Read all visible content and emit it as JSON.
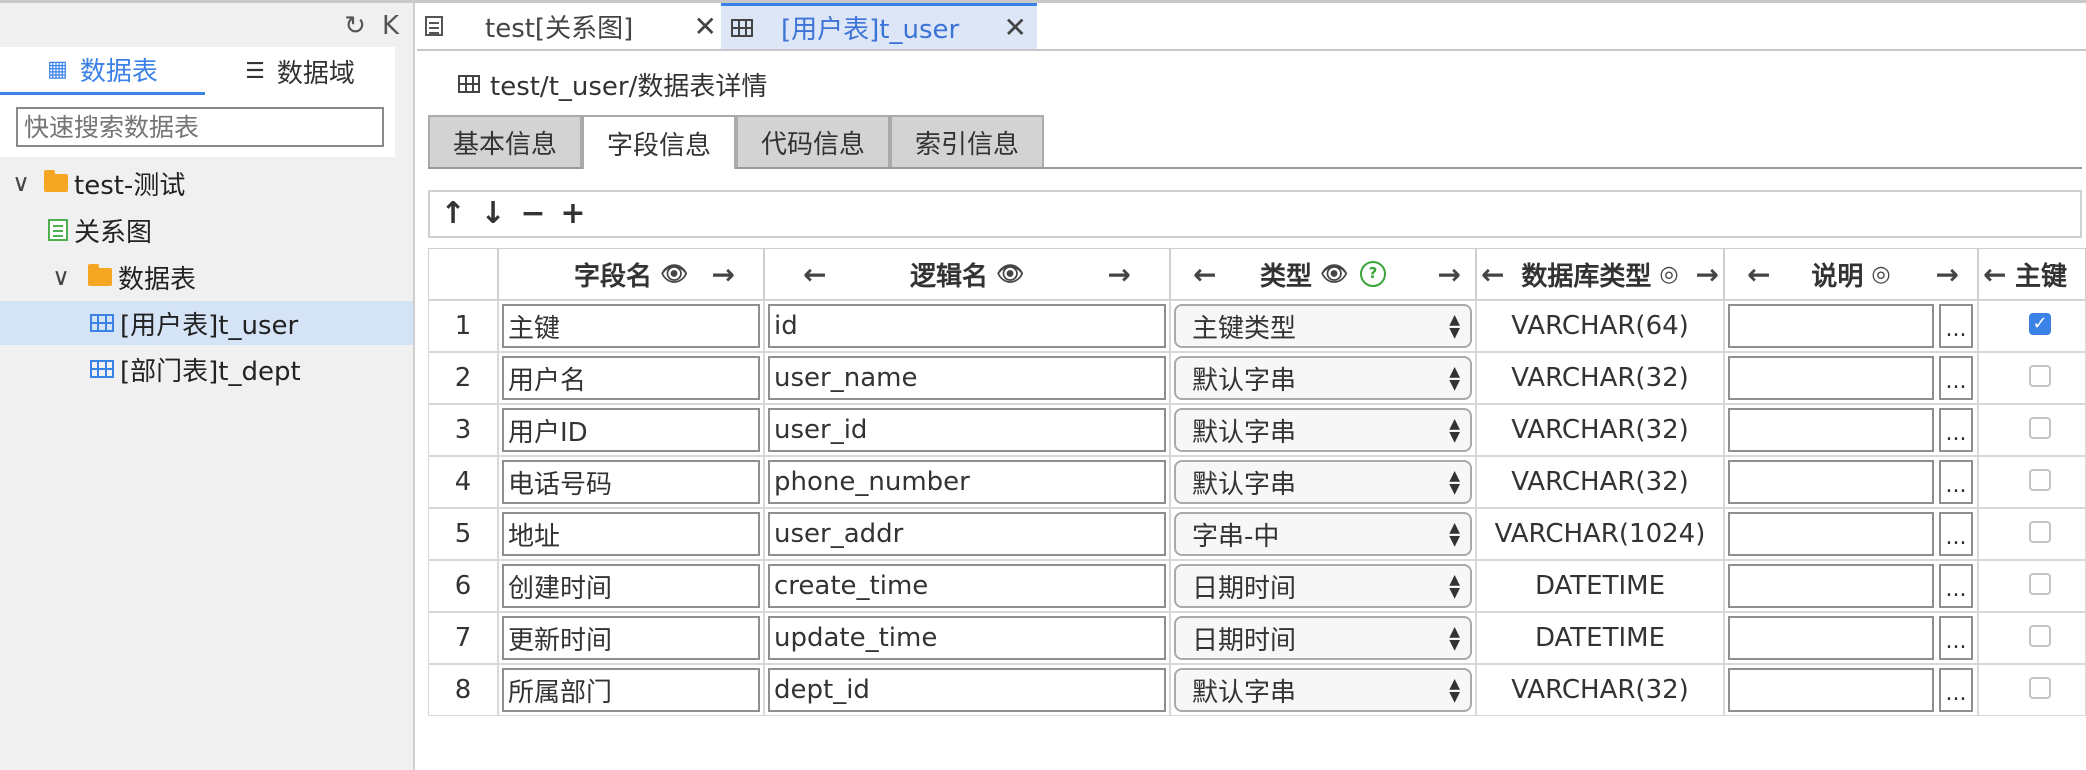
{
  "sidebar": {
    "tabs": [
      {
        "label": "数据表",
        "icon": "grid-icon"
      },
      {
        "label": "数据域",
        "icon": "list-icon"
      }
    ],
    "search_placeholder": "快速搜索数据表",
    "tree": {
      "root": "test-测试",
      "diagram": "关系图",
      "folder": "数据表",
      "tables": [
        "[用户表]t_user",
        "[部门表]t_dept"
      ],
      "selected": "[用户表]t_user"
    }
  },
  "tabs": [
    {
      "label": "test[关系图]",
      "icon": "diagram-icon",
      "active": false
    },
    {
      "label": "[用户表]t_user",
      "icon": "table-icon",
      "active": true
    }
  ],
  "breadcrumb": "test/t_user/数据表详情",
  "subtabs": [
    "基本信息",
    "字段信息",
    "代码信息",
    "索引信息"
  ],
  "active_subtab": "字段信息",
  "toolbar": {
    "up": "↑",
    "down": "↓",
    "minus": "−",
    "plus": "+"
  },
  "columns": {
    "field": "字段名",
    "logic": "逻辑名",
    "type": "类型",
    "dbtype": "数据库类型",
    "desc": "说明",
    "pk": "主键"
  },
  "rows": [
    {
      "n": "1",
      "field": "主键",
      "logic": "id",
      "type": "主键类型",
      "dbtype": "VARCHAR(64)",
      "pk": true
    },
    {
      "n": "2",
      "field": "用户名",
      "logic": "user_name",
      "type": "默认字串",
      "dbtype": "VARCHAR(32)",
      "pk": false
    },
    {
      "n": "3",
      "field": "用户ID",
      "logic": "user_id",
      "type": "默认字串",
      "dbtype": "VARCHAR(32)",
      "pk": false
    },
    {
      "n": "4",
      "field": "电话号码",
      "logic": "phone_number",
      "type": "默认字串",
      "dbtype": "VARCHAR(32)",
      "pk": false
    },
    {
      "n": "5",
      "field": "地址",
      "logic": "user_addr",
      "type": "字串-中",
      "dbtype": "VARCHAR(1024)",
      "pk": false
    },
    {
      "n": "6",
      "field": "创建时间",
      "logic": "create_time",
      "type": "日期时间",
      "dbtype": "DATETIME",
      "pk": false
    },
    {
      "n": "7",
      "field": "更新时间",
      "logic": "update_time",
      "type": "日期时间",
      "dbtype": "DATETIME",
      "pk": false
    },
    {
      "n": "8",
      "field": "所属部门",
      "logic": "dept_id",
      "type": "默认字串",
      "dbtype": "VARCHAR(32)",
      "pk": false
    }
  ],
  "ellipsis": "...",
  "colors": {
    "accent": "#3b82e6",
    "selected_bg": "#d5e3f7",
    "folder": "#f5a623",
    "help": "#3aa33a"
  }
}
